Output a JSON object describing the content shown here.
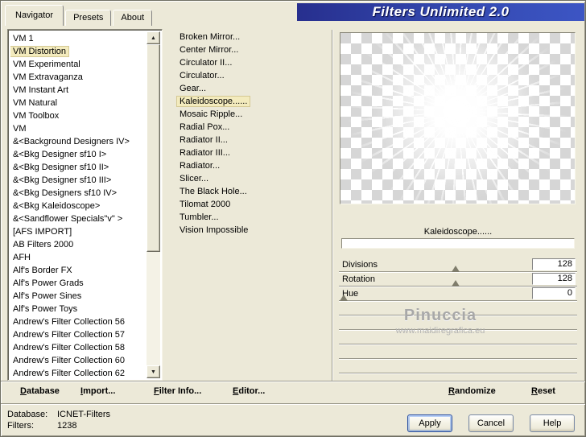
{
  "title": "Filters Unlimited 2.0",
  "tabs": {
    "items": [
      {
        "label": "Navigator"
      },
      {
        "label": "Presets"
      },
      {
        "label": "About"
      }
    ],
    "active_index": 0
  },
  "icons": {
    "scroll_up": "▲",
    "scroll_down": "▼"
  },
  "categories": {
    "selected_index": 1,
    "items": [
      "VM 1",
      "VM Distortion",
      "VM Experimental",
      "VM Extravaganza",
      "VM Instant Art",
      "VM Natural",
      "VM Toolbox",
      "VM",
      "&<Background Designers IV>",
      "&<Bkg Designer sf10 I>",
      "&<Bkg Designer sf10 II>",
      "&<Bkg Designer sf10 III>",
      "&<Bkg Designers sf10 IV>",
      "&<Bkg Kaleidoscope>",
      "&<Sandflower Specials\"v\" >",
      "[AFS IMPORT]",
      "AB Filters 2000",
      "AFH",
      "Alf's Border FX",
      "Alf's Power Grads",
      "Alf's Power Sines",
      "Alf's Power Toys",
      "Andrew's Filter Collection 56",
      "Andrew's Filter Collection 57",
      "Andrew's Filter Collection 58",
      "Andrew's Filter Collection 60",
      "Andrew's Filter Collection 62"
    ]
  },
  "filters_list": {
    "selected_index": 5,
    "items": [
      "Broken Mirror...",
      "Center Mirror...",
      "Circulator II...",
      "Circulator...",
      "Gear...",
      "Kaleidoscope......",
      "Mosaic Ripple...",
      "Radial Pox...",
      "Radiator II...",
      "Radiator III...",
      "Radiator...",
      "Slicer...",
      "The Black Hole...",
      "Tilomat 2000",
      "Tumbler...",
      "Vision Impossible"
    ]
  },
  "preview": {
    "caption": "Kaleidoscope......"
  },
  "params": {
    "rows": [
      {
        "name": "Divisions",
        "value": "128",
        "pos": 0.49
      },
      {
        "name": "Rotation",
        "value": "128",
        "pos": 0.49
      },
      {
        "name": "Hue",
        "value": "0",
        "pos": 0.02
      }
    ]
  },
  "watermark": {
    "name": "Pinuccia",
    "url": "www.maidiregrafica.eu"
  },
  "toolbar": {
    "items": [
      "Database",
      "Import...",
      "Filter Info...",
      "Editor...",
      "Randomize",
      "Reset"
    ]
  },
  "status": {
    "database_label": "Database:",
    "database_value": "ICNET-Filters",
    "filters_label": "Filters:",
    "filters_value": "1238"
  },
  "action_buttons": {
    "apply": "Apply",
    "cancel": "Cancel",
    "help": "Help"
  },
  "colors": {
    "selection_bg": "#f3ebbd",
    "title_start": "#272f8e",
    "title_end": "#3c55c4"
  }
}
